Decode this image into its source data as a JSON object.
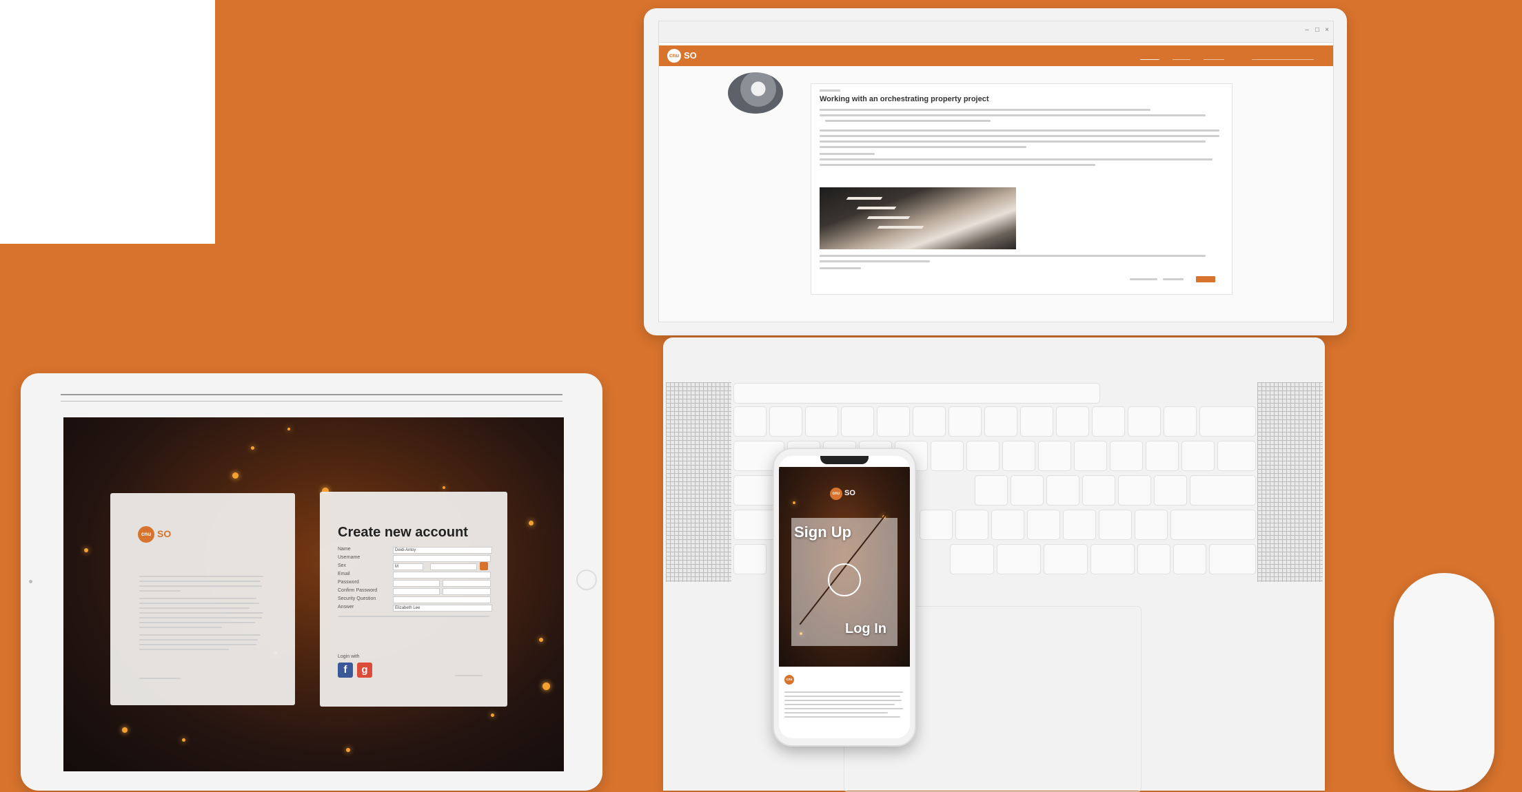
{
  "colors": {
    "background": "#d8732d",
    "accent": "#d8732d",
    "device": "#f3f3f3"
  },
  "laptop": {
    "site_logo_badge": "cnu",
    "site_logo_text": "SO",
    "post_title": "Working with an orchestrating property project",
    "image_subject": "staircase"
  },
  "tablet": {
    "logo_badge": "cnu",
    "logo_text": "SO",
    "create_title": "Create new account",
    "form_labels": [
      "Name",
      "Username",
      "Sex",
      "Email",
      "Password",
      "Confirm Password",
      "Security Question",
      "Answer"
    ],
    "form_values": [
      "Deidi Antoy",
      "",
      "M",
      "",
      "",
      "",
      "",
      "Elizabeth Lee"
    ],
    "login_with": "Login with",
    "social": [
      {
        "icon": "facebook-icon",
        "glyph": "f",
        "color": "#3b5998"
      },
      {
        "icon": "google-plus-icon",
        "glyph": "g",
        "color": "#dd4b39"
      }
    ]
  },
  "phone": {
    "logo_badge": "cnu",
    "logo_text": "SO",
    "signup": "Sign Up",
    "login": "Log In"
  }
}
